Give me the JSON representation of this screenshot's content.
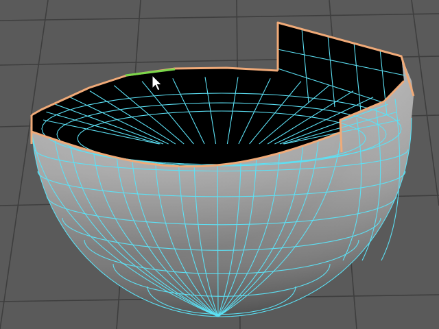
{
  "app": {
    "context": "3d-modeling-viewport",
    "view": "perspective"
  },
  "scene": {
    "object": {
      "type": "polygon-hemisphere",
      "component_mode": "edge",
      "border_edges_highlighted": true,
      "hovered_edge_preselected": true
    },
    "display": {
      "wireframe_on_shaded": true,
      "grid_visible": true
    }
  },
  "colors": {
    "viewport_background": "#5a5a5a",
    "grid_line": "#3e3e3e",
    "shaded_surface_light": "#b4b4b4",
    "shaded_surface_dark": "#545454",
    "interior_void": "#000000",
    "wireframe": "#5ce1f5",
    "border_edge_highlight": "#f0aa78",
    "preselected_edge": "#7ad84a",
    "cursor_fill": "#ffffff",
    "cursor_outline": "#000000"
  },
  "icons": {
    "cursor": "arrow-cursor-icon"
  }
}
